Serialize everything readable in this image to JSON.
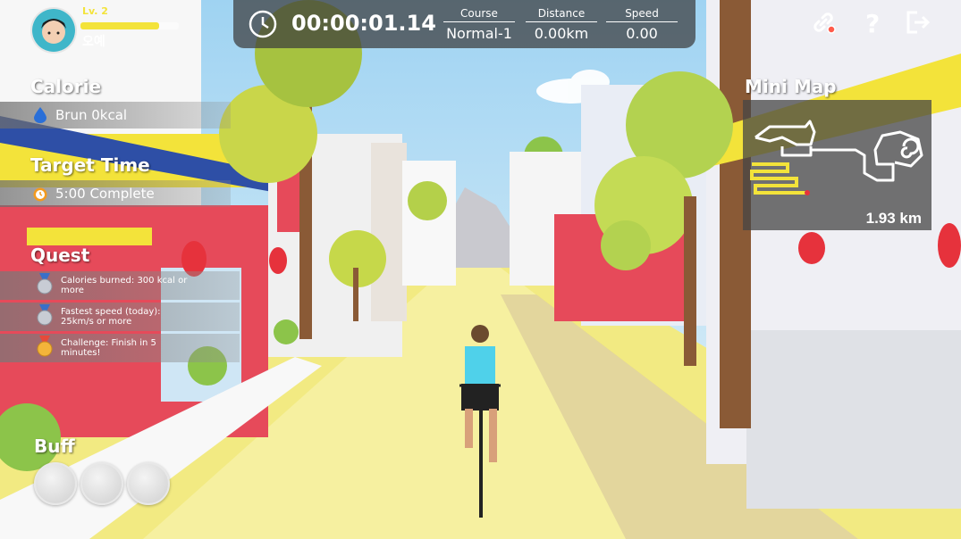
{
  "player": {
    "level": "Lv. 2",
    "name": "오예",
    "xp_fraction": 0.8
  },
  "calorie": {
    "title": "Calorie",
    "value": "Brun 0kcal"
  },
  "target_time": {
    "title": "Target Time",
    "value": "5:00 Complete"
  },
  "quest": {
    "title": "Quest",
    "items": [
      {
        "medal": "silver",
        "text": "Calories burned: 300 kcal or more"
      },
      {
        "medal": "silver",
        "text": "Fastest speed (today): 25km/s or more"
      },
      {
        "medal": "gold",
        "text": "Challenge: Finish in 5 minutes!"
      }
    ]
  },
  "buff": {
    "title": "Buff",
    "slots": 3
  },
  "timer": {
    "value": "00:00:01.14",
    "icon": "clock-icon"
  },
  "stats": {
    "course_label": "Course",
    "course_value": "Normal-1",
    "distance_label": "Distance",
    "distance_value": "0.00km",
    "speed_label": "Speed",
    "speed_value": "0.00"
  },
  "minimap": {
    "title": "Mini Map",
    "distance": "1.93 km"
  },
  "icons": {
    "link": "link-icon",
    "help": "help-icon",
    "exit": "exit-icon"
  },
  "colors": {
    "accent_yellow": "#f3e33a",
    "road": "#f5ef8a"
  }
}
